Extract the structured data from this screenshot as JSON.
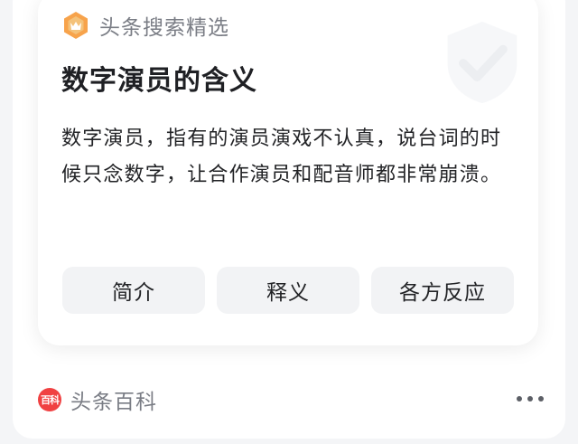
{
  "header": {
    "label": "头条搜索精选",
    "icon": "search-pick-badge-icon",
    "icon_colors": [
      "#f7a34b",
      "#f4c27a"
    ]
  },
  "card": {
    "title": "数字演员的含义",
    "description": "数字演员，指有的演员演戏不认真，说台词的时候只念数字，让合作演员和配音师都非常崩溃。",
    "chips": [
      {
        "label": "简介"
      },
      {
        "label": "释义"
      },
      {
        "label": "各方反应"
      }
    ]
  },
  "footer": {
    "source_icon_text": "百科",
    "source_label": "头条百科",
    "more_icon": "more-dots-icon",
    "accent": "#f04142"
  }
}
